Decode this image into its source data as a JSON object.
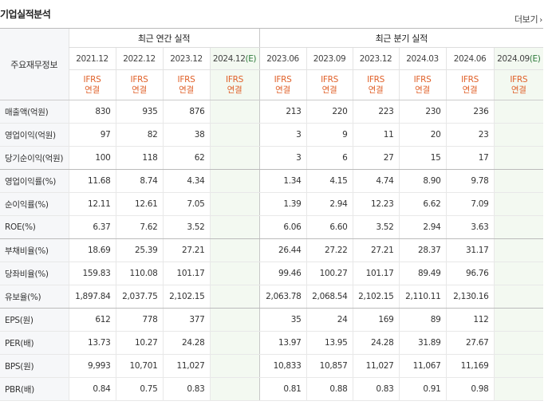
{
  "header": {
    "title": "기업실적분석",
    "more_label": "더보기",
    "more_arrow": "›"
  },
  "table": {
    "label_header": "주요재무정보",
    "annual_header": "최근 연간 실적",
    "quarter_header": "최근 분기 실적",
    "annual_periods": [
      {
        "label": "2021.12",
        "est": ""
      },
      {
        "label": "2022.12",
        "est": ""
      },
      {
        "label": "2023.12",
        "est": ""
      },
      {
        "label": "2024.12",
        "est": "(E)"
      }
    ],
    "quarter_periods": [
      {
        "label": "2023.06",
        "est": ""
      },
      {
        "label": "2023.09",
        "est": ""
      },
      {
        "label": "2023.12",
        "est": ""
      },
      {
        "label": "2024.03",
        "est": ""
      },
      {
        "label": "2024.06",
        "est": ""
      },
      {
        "label": "2024.09",
        "est": "(E)"
      }
    ],
    "std_line1": "IFRS",
    "std_line2": "연결",
    "rows": [
      {
        "label": "매출액(억원)",
        "annual": [
          "830",
          "935",
          "876",
          ""
        ],
        "quarter": [
          "213",
          "220",
          "223",
          "230",
          "236",
          ""
        ]
      },
      {
        "label": "영업이익(억원)",
        "annual": [
          "97",
          "82",
          "38",
          ""
        ],
        "quarter": [
          "3",
          "9",
          "11",
          "20",
          "23",
          ""
        ]
      },
      {
        "label": "당기순이익(억원)",
        "annual": [
          "100",
          "118",
          "62",
          ""
        ],
        "quarter": [
          "3",
          "6",
          "27",
          "15",
          "17",
          ""
        ]
      },
      {
        "label": "영업이익률(%)",
        "annual": [
          "11.68",
          "8.74",
          "4.34",
          ""
        ],
        "quarter": [
          "1.34",
          "4.15",
          "4.74",
          "8.90",
          "9.78",
          ""
        ]
      },
      {
        "label": "순이익률(%)",
        "annual": [
          "12.11",
          "12.61",
          "7.05",
          ""
        ],
        "quarter": [
          "1.39",
          "2.94",
          "12.23",
          "6.62",
          "7.09",
          ""
        ]
      },
      {
        "label": "ROE(%)",
        "annual": [
          "6.37",
          "7.62",
          "3.52",
          ""
        ],
        "quarter": [
          "6.06",
          "6.60",
          "3.52",
          "2.94",
          "3.63",
          ""
        ]
      },
      {
        "label": "부채비율(%)",
        "annual": [
          "18.69",
          "25.39",
          "27.21",
          ""
        ],
        "quarter": [
          "26.44",
          "27.22",
          "27.21",
          "28.37",
          "31.17",
          ""
        ]
      },
      {
        "label": "당좌비율(%)",
        "annual": [
          "159.83",
          "110.08",
          "101.17",
          ""
        ],
        "quarter": [
          "99.46",
          "100.27",
          "101.17",
          "89.49",
          "96.76",
          ""
        ]
      },
      {
        "label": "유보율(%)",
        "annual": [
          "1,897.84",
          "2,037.75",
          "2,102.15",
          ""
        ],
        "quarter": [
          "2,063.78",
          "2,068.54",
          "2,102.15",
          "2,110.11",
          "2,130.16",
          ""
        ]
      },
      {
        "label": "EPS(원)",
        "annual": [
          "612",
          "778",
          "377",
          ""
        ],
        "quarter": [
          "35",
          "24",
          "169",
          "89",
          "112",
          ""
        ]
      },
      {
        "label": "PER(배)",
        "annual": [
          "13.73",
          "10.27",
          "24.28",
          ""
        ],
        "quarter": [
          "13.97",
          "13.95",
          "24.28",
          "31.89",
          "27.67",
          ""
        ]
      },
      {
        "label": "BPS(원)",
        "annual": [
          "9,993",
          "10,701",
          "11,027",
          ""
        ],
        "quarter": [
          "10,833",
          "10,857",
          "11,027",
          "11,067",
          "11,169",
          ""
        ]
      },
      {
        "label": "PBR(배)",
        "annual": [
          "0.84",
          "0.75",
          "0.83",
          ""
        ],
        "quarter": [
          "0.81",
          "0.88",
          "0.83",
          "0.91",
          "0.98",
          ""
        ]
      }
    ],
    "group_ends": [
      2,
      5,
      8
    ]
  },
  "colors": {
    "accent_orange": "#e0612a",
    "estimate_green": "#2d7a3a",
    "estimate_bg": "#f3f9f1",
    "label_bg": "#f6f7f9"
  }
}
